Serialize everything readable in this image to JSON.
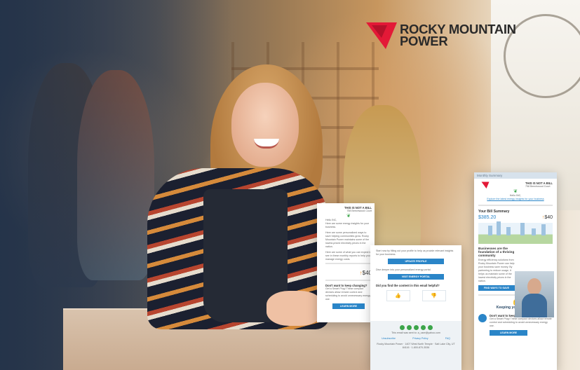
{
  "brand": {
    "name_line1": "ROCKY MOUNTAIN",
    "name_line2": "POWER",
    "accent_color": "#e31937"
  },
  "email_left": {
    "header_tag": "THIS IS NOT A BILL",
    "address": "758 Beechwood Court",
    "greeting": "Hello INC,",
    "intro": "Here are some energy insights for your business.",
    "body": "Here are some personalized ways to save helping communities grow. Rocky Mountain Power maintains some of the lowest-priced electricity prices in the nation.",
    "body2": "Here are some of what you can expect to see in these monthly reports to help you manage energy costs.",
    "amount": "$40",
    "promo_title": "Don't want to keep changing?",
    "promo_body": "Get a Smart Plug! These compact devices allow remote control and scheduling to avoid unnecessary energy use.",
    "button": "LEARN MORE"
  },
  "email_middle": {
    "text1": "Start now by filling out your profile to help us provide relevant insights for your business.",
    "button1": "UPDATE PROFILE",
    "text2": "Dive deeper into your personalized energy portal.",
    "button2": "VISIT ENERGY PORTAL",
    "question": "Did you find the content in this email helpful?",
    "footer_note": "This email was sent to: a_user@yahoo.com",
    "links": [
      "Unsubscribe",
      "Privacy Policy",
      "FAQ"
    ],
    "address": "Rocky Mountain Power · 1407 West North Temple · Salt Lake City, UT 84116 · 1-800-870-3536"
  },
  "email_right": {
    "summary_label": "Monthly Summary",
    "header_tag": "THIS IS NOT A BILL",
    "address": "758 Beechwood Court",
    "greeting": "Hello INC,",
    "explore_link": "Explore the latest energy insights for your business",
    "bill_label": "Your Bill Summary",
    "bill_amount": "$385.20",
    "savings": "$40",
    "feature_title": "Businesses are the foundation of a thriving community",
    "feature_body": "Energy efficiency solutions from Rocky Mountain Power can help your business save money. By partnering to reduce usage, it helps us maintain some of the lowest electricity prices in the nation.",
    "feature_button": "FIND WAYS TO SAVE",
    "section_title": "Keeping you informed",
    "promo_title": "Don't want to keep changing?",
    "promo_body": "Get a Smart Plug! These compact devices allow remote control and scheduling to avoid unnecessary energy use.",
    "promo_button": "LEARN MORE"
  }
}
